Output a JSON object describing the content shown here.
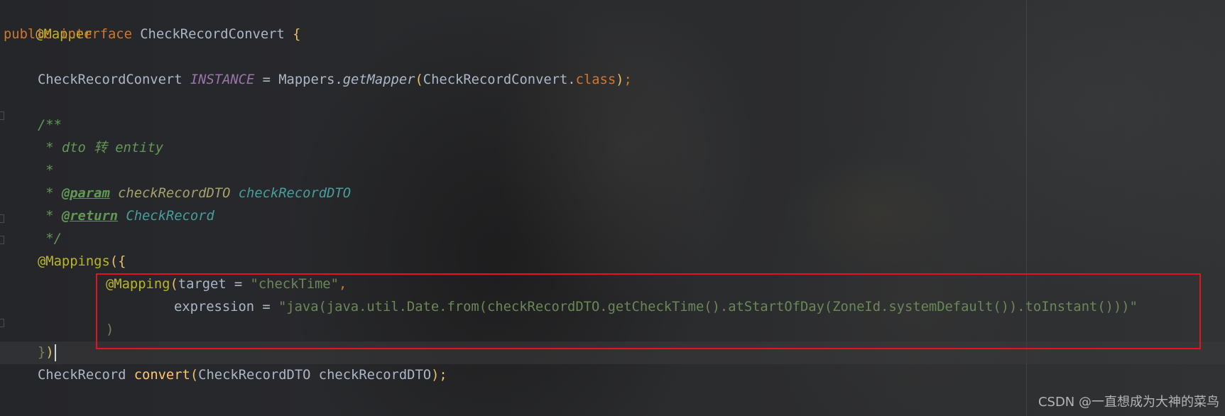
{
  "code": {
    "ann_mapper": "@Mapper",
    "kw_public": "public",
    "kw_interface": "interface",
    "interface_name": "CheckRecordConvert",
    "open_brace": "{",
    "field_type": "CheckRecordConvert",
    "field_name": "INSTANCE",
    "field_eq": " = ",
    "mappers_cls": "Mappers.",
    "get_mapper": "getMapper",
    "paren_open": "(",
    "class_ref": "CheckRecordConvert.",
    "kw_class": "class",
    "paren_close": ")",
    "semicolon": ";",
    "doc_open": "/**",
    "doc_line1": " * dto 转 entity",
    "doc_star": " *",
    "doc_star_prefix": " * ",
    "doc_tag_param": "@param",
    "doc_param_name": "checkRecordDTO",
    "doc_param_desc": "checkRecordDTO",
    "doc_tag_return": "@return",
    "doc_return_desc": "CheckRecord",
    "doc_close": " */",
    "ann_mappings": "@Mappings",
    "mappings_open": "({",
    "ann_mapping": "@Mapping",
    "mapping_open": "(",
    "target_key": "target = ",
    "target_val": "\"checkTime\"",
    "comma": ",",
    "expr_key": "expression = ",
    "expr_val": "\"java(java.util.Date.from(checkRecordDTO.getCheckTime().atStartOfDay(ZoneId.systemDefault()).toInstant()))\"",
    "mapping_close": ")",
    "mappings_close_brace": "}",
    "mappings_close_paren": ")",
    "ret_type": "CheckRecord",
    "method_name": "convert",
    "param_type": "CheckRecordDTO",
    "param_name": "checkRecordDTO",
    "method_end": ");"
  },
  "watermark": "CSDN @一直想成为大神的菜鸟",
  "colors": {
    "background": "#232426",
    "keyword": "#cc7832",
    "annotation": "#bbb529",
    "string": "#6a8759",
    "doc_comment": "#629755",
    "constant": "#9876aa",
    "method": "#ffc66d",
    "highlight_box": "#e0161f"
  }
}
